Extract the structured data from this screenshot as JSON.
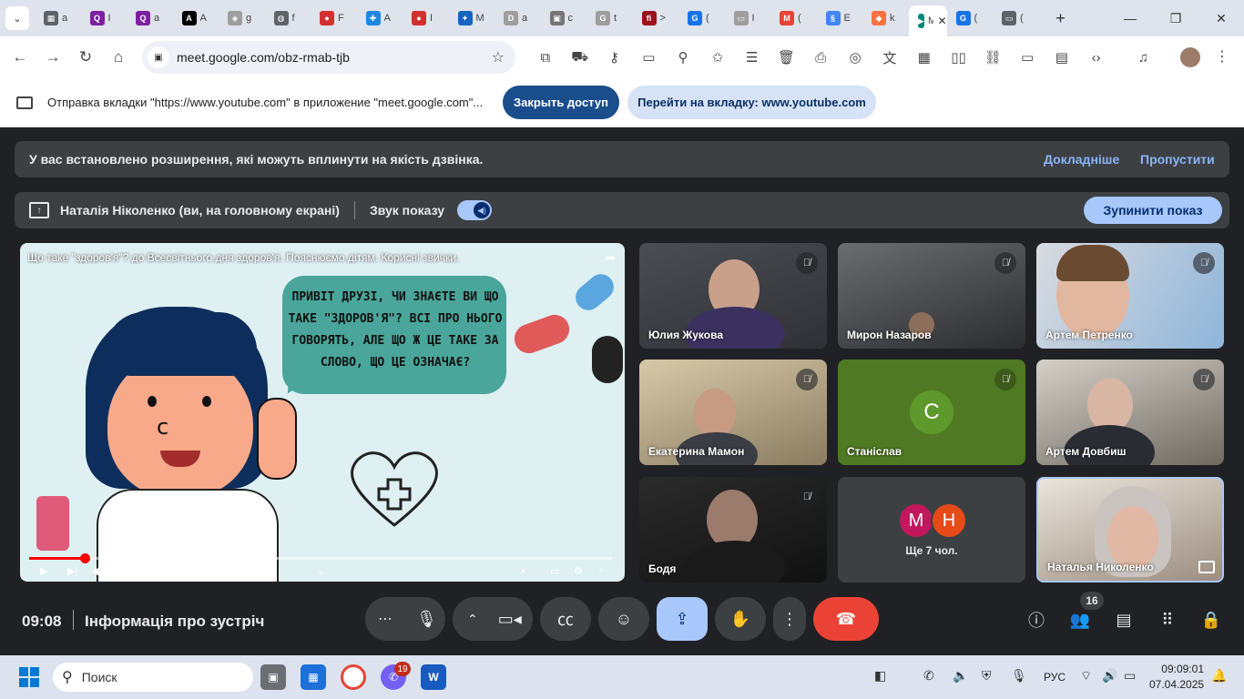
{
  "browser": {
    "tabs": [
      {
        "icon": "grid-icon",
        "color": "#5f6368",
        "label": "a"
      },
      {
        "icon": "q-icon",
        "color": "#7e1fa0",
        "label": "I"
      },
      {
        "icon": "q-icon",
        "color": "#7e1fa0",
        "label": "a"
      },
      {
        "icon": "a-icon",
        "color": "#000000",
        "label": "A"
      },
      {
        "icon": "box-icon",
        "color": "#9e9e9e",
        "label": "g"
      },
      {
        "icon": "globe-icon",
        "color": "#5f6368",
        "label": "f"
      },
      {
        "icon": "ball-icon",
        "color": "#d32f2f",
        "label": "F"
      },
      {
        "icon": "puzzle-icon",
        "color": "#1e88e5",
        "label": "A"
      },
      {
        "icon": "ball-icon",
        "color": "#d32f2f",
        "label": "I"
      },
      {
        "icon": "sparkle-icon",
        "color": "#1565c0",
        "label": "M"
      },
      {
        "icon": "d-icon",
        "color": "#9e9e9e",
        "label": "a"
      },
      {
        "icon": "photo-icon",
        "color": "#757575",
        "label": "c"
      },
      {
        "icon": "g-icon",
        "color": "#9e9e9e",
        "label": "t"
      },
      {
        "icon": "fi-icon",
        "color": "#9b111e",
        "label": ">"
      },
      {
        "icon": "g-icon",
        "color": "#1a73e8",
        "label": "("
      },
      {
        "icon": "screen-icon",
        "color": "#9e9e9e",
        "label": "I"
      },
      {
        "icon": "gmail-icon",
        "color": "#ea4335",
        "label": "("
      },
      {
        "icon": "swirl-icon",
        "color": "#4285f4",
        "label": "E"
      },
      {
        "icon": "fox-icon",
        "color": "#ff7043",
        "label": "k"
      },
      {
        "icon": "meet-icon",
        "color": "#00897b",
        "label": "M",
        "active": true
      },
      {
        "icon": "g-icon",
        "color": "#1a73e8",
        "label": "("
      },
      {
        "icon": "screen-icon",
        "color": "#5f6368",
        "label": "("
      }
    ],
    "new_tab_label": "+",
    "url": "meet.google.com/obz-rmab-tjb"
  },
  "sharebar": {
    "message": "Отправка вкладки \"https://www.youtube.com\" в приложение \"meet.google.com\"...",
    "stop_access_label": "Закрыть доступ",
    "go_to_tab_label": "Перейти на вкладку: www.youtube.com"
  },
  "meet": {
    "extension_warning": "У вас встановлено розширення, які можуть вплинути на якість дзвінка.",
    "learn_more": "Докладніше",
    "skip": "Пропустити",
    "presenter": "Наталія Ніколенко (ви, на головному екрані)",
    "audio_label": "Звук показу",
    "stop_presenting": "Зупинити показ",
    "video": {
      "title": "Що таке \"здоров'я\"? до Всесвітнього дня здоров'я. Пояснюємо дітям. Корисні звички.",
      "bubble_text": "ПРИВІТ ДРУЗІ, ЧИ ЗНАЄТЕ ВИ ЩО ТАКЕ \"ЗДОРОВ'Я\"? ВСІ ПРО НЬОГО ГОВОРЯТЬ, АЛЕ ЩО Ж ЦЕ ТАКЕ ЗА СЛОВО, ЩО ЦЕ ОЗНАЧАЄ?",
      "time": "0:12 / 2:06",
      "progress": 0.095
    },
    "participants": [
      {
        "name": "Юлия Жукова",
        "muted": true
      },
      {
        "name": "Мирон Назаров",
        "muted": true
      },
      {
        "name": "Артем Петренко",
        "muted": true
      },
      {
        "name": "Екатерина Мамон",
        "muted": true
      },
      {
        "name": "Станіслав",
        "muted": true,
        "initial": "С"
      },
      {
        "name": "Артем Довбиш",
        "muted": true
      },
      {
        "name": "Бодя",
        "muted": true
      },
      {
        "name": "Ще 7 чол.",
        "initials": [
          "М",
          "Н"
        ]
      },
      {
        "name": "Наталья Николенко"
      }
    ],
    "bottom": {
      "time": "09:08",
      "meeting_info": "Інформація про зустріч",
      "participants_count": "16"
    }
  },
  "taskbar": {
    "search_placeholder": "Поиск",
    "viber_badge": "19",
    "language": "РУС",
    "time": "09:09:01",
    "date": "07.04.2025"
  }
}
